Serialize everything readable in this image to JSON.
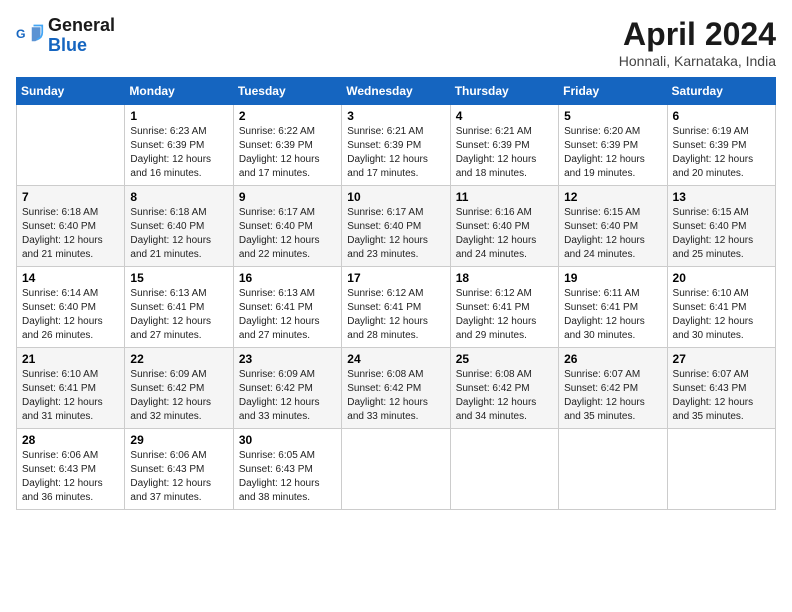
{
  "logo": {
    "line1": "General",
    "line2": "Blue"
  },
  "title": "April 2024",
  "subtitle": "Honnali, Karnataka, India",
  "days_of_week": [
    "Sunday",
    "Monday",
    "Tuesday",
    "Wednesday",
    "Thursday",
    "Friday",
    "Saturday"
  ],
  "weeks": [
    [
      {
        "day": "",
        "info": ""
      },
      {
        "day": "1",
        "info": "Sunrise: 6:23 AM\nSunset: 6:39 PM\nDaylight: 12 hours and 16 minutes."
      },
      {
        "day": "2",
        "info": "Sunrise: 6:22 AM\nSunset: 6:39 PM\nDaylight: 12 hours and 17 minutes."
      },
      {
        "day": "3",
        "info": "Sunrise: 6:21 AM\nSunset: 6:39 PM\nDaylight: 12 hours and 17 minutes."
      },
      {
        "day": "4",
        "info": "Sunrise: 6:21 AM\nSunset: 6:39 PM\nDaylight: 12 hours and 18 minutes."
      },
      {
        "day": "5",
        "info": "Sunrise: 6:20 AM\nSunset: 6:39 PM\nDaylight: 12 hours and 19 minutes."
      },
      {
        "day": "6",
        "info": "Sunrise: 6:19 AM\nSunset: 6:39 PM\nDaylight: 12 hours and 20 minutes."
      }
    ],
    [
      {
        "day": "7",
        "info": "Sunrise: 6:18 AM\nSunset: 6:40 PM\nDaylight: 12 hours and 21 minutes."
      },
      {
        "day": "8",
        "info": "Sunrise: 6:18 AM\nSunset: 6:40 PM\nDaylight: 12 hours and 21 minutes."
      },
      {
        "day": "9",
        "info": "Sunrise: 6:17 AM\nSunset: 6:40 PM\nDaylight: 12 hours and 22 minutes."
      },
      {
        "day": "10",
        "info": "Sunrise: 6:17 AM\nSunset: 6:40 PM\nDaylight: 12 hours and 23 minutes."
      },
      {
        "day": "11",
        "info": "Sunrise: 6:16 AM\nSunset: 6:40 PM\nDaylight: 12 hours and 24 minutes."
      },
      {
        "day": "12",
        "info": "Sunrise: 6:15 AM\nSunset: 6:40 PM\nDaylight: 12 hours and 24 minutes."
      },
      {
        "day": "13",
        "info": "Sunrise: 6:15 AM\nSunset: 6:40 PM\nDaylight: 12 hours and 25 minutes."
      }
    ],
    [
      {
        "day": "14",
        "info": "Sunrise: 6:14 AM\nSunset: 6:40 PM\nDaylight: 12 hours and 26 minutes."
      },
      {
        "day": "15",
        "info": "Sunrise: 6:13 AM\nSunset: 6:41 PM\nDaylight: 12 hours and 27 minutes."
      },
      {
        "day": "16",
        "info": "Sunrise: 6:13 AM\nSunset: 6:41 PM\nDaylight: 12 hours and 27 minutes."
      },
      {
        "day": "17",
        "info": "Sunrise: 6:12 AM\nSunset: 6:41 PM\nDaylight: 12 hours and 28 minutes."
      },
      {
        "day": "18",
        "info": "Sunrise: 6:12 AM\nSunset: 6:41 PM\nDaylight: 12 hours and 29 minutes."
      },
      {
        "day": "19",
        "info": "Sunrise: 6:11 AM\nSunset: 6:41 PM\nDaylight: 12 hours and 30 minutes."
      },
      {
        "day": "20",
        "info": "Sunrise: 6:10 AM\nSunset: 6:41 PM\nDaylight: 12 hours and 30 minutes."
      }
    ],
    [
      {
        "day": "21",
        "info": "Sunrise: 6:10 AM\nSunset: 6:41 PM\nDaylight: 12 hours and 31 minutes."
      },
      {
        "day": "22",
        "info": "Sunrise: 6:09 AM\nSunset: 6:42 PM\nDaylight: 12 hours and 32 minutes."
      },
      {
        "day": "23",
        "info": "Sunrise: 6:09 AM\nSunset: 6:42 PM\nDaylight: 12 hours and 33 minutes."
      },
      {
        "day": "24",
        "info": "Sunrise: 6:08 AM\nSunset: 6:42 PM\nDaylight: 12 hours and 33 minutes."
      },
      {
        "day": "25",
        "info": "Sunrise: 6:08 AM\nSunset: 6:42 PM\nDaylight: 12 hours and 34 minutes."
      },
      {
        "day": "26",
        "info": "Sunrise: 6:07 AM\nSunset: 6:42 PM\nDaylight: 12 hours and 35 minutes."
      },
      {
        "day": "27",
        "info": "Sunrise: 6:07 AM\nSunset: 6:43 PM\nDaylight: 12 hours and 35 minutes."
      }
    ],
    [
      {
        "day": "28",
        "info": "Sunrise: 6:06 AM\nSunset: 6:43 PM\nDaylight: 12 hours and 36 minutes."
      },
      {
        "day": "29",
        "info": "Sunrise: 6:06 AM\nSunset: 6:43 PM\nDaylight: 12 hours and 37 minutes."
      },
      {
        "day": "30",
        "info": "Sunrise: 6:05 AM\nSunset: 6:43 PM\nDaylight: 12 hours and 38 minutes."
      },
      {
        "day": "",
        "info": ""
      },
      {
        "day": "",
        "info": ""
      },
      {
        "day": "",
        "info": ""
      },
      {
        "day": "",
        "info": ""
      }
    ]
  ]
}
